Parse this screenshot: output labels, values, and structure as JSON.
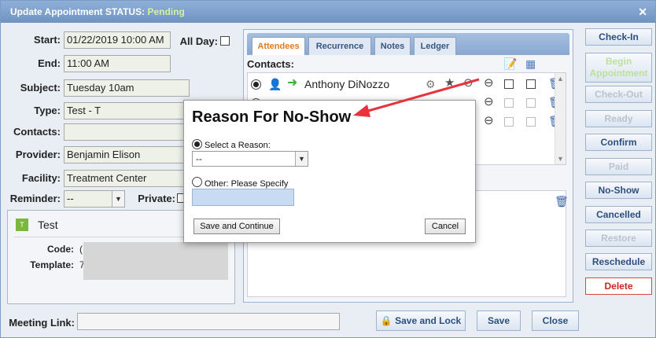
{
  "window": {
    "title_prefix": "Update Appointment STATUS: ",
    "title_status": "Pending",
    "close_glyph": "✕"
  },
  "form": {
    "start_label": "Start:",
    "start_value": "01/22/2019 10:00 AM",
    "allday_label": "All Day:",
    "end_label": "End:",
    "end_value": "11:00 AM",
    "subject_label": "Subject:",
    "subject_value": "Tuesday 10am",
    "type_label": "Type:",
    "type_value": "Test - T",
    "contacts_label": "Contacts:",
    "provider_label": "Provider:",
    "provider_value": "Benjamin Elison",
    "facility_label": "Facility:",
    "facility_value": "Treatment Center",
    "reminder_label": "Reminder:",
    "reminder_value": "--",
    "private_label": "Private:"
  },
  "template_panel": {
    "badge": "T",
    "name": "Test",
    "code_label": "Code:",
    "code_value": "(",
    "template_label": "Template:",
    "template_value": "7"
  },
  "tabs": [
    {
      "label": "Attendees",
      "active": true
    },
    {
      "label": "Recurrence",
      "active": false
    },
    {
      "label": "Notes",
      "active": false
    },
    {
      "label": "Ledger",
      "active": false
    }
  ],
  "attendees": {
    "header": "Contacts:",
    "first_contact": "Anthony DiNozzo"
  },
  "side_buttons": [
    {
      "label": "Check-In",
      "state": "enabled"
    },
    {
      "label": "Begin Appointment",
      "state": "begin"
    },
    {
      "label": "Check-Out",
      "state": "disabled"
    },
    {
      "label": "Ready",
      "state": "disabled"
    },
    {
      "label": "Confirm",
      "state": "enabled"
    },
    {
      "label": "Paid",
      "state": "disabled"
    },
    {
      "label": "No-Show",
      "state": "enabled"
    },
    {
      "label": "Cancelled",
      "state": "enabled"
    },
    {
      "label": "Restore",
      "state": "disabled"
    },
    {
      "label": "Reschedule",
      "state": "enabled"
    },
    {
      "label": "Delete",
      "state": "delete"
    }
  ],
  "footer": {
    "meeting_link_label": "Meeting Link:",
    "save_lock_label": "Save and Lock",
    "save_label": "Save",
    "close_label": "Close"
  },
  "modal": {
    "title": "Reason For No-Show",
    "select_reason_label": "Select a Reason:",
    "select_value": "--",
    "other_label": "Other: Please Specify",
    "save_continue_label": "Save and Continue",
    "cancel_label": "Cancel"
  },
  "colors": {
    "accent_orange": "#e07b22",
    "arrow_red": "#e8323c",
    "status_green": "#d8f0a0"
  }
}
